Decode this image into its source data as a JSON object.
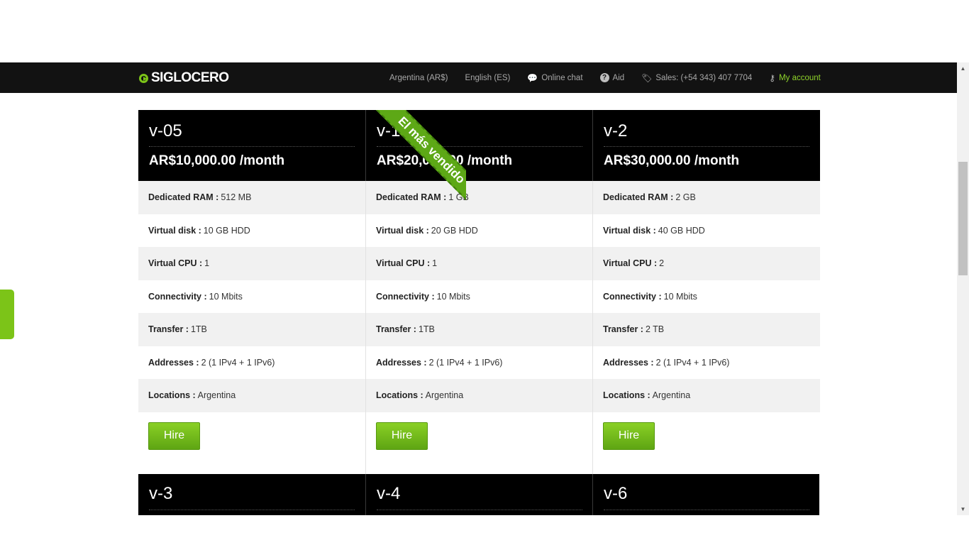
{
  "header": {
    "logo_text": "SIGLOCERO",
    "region": "Argentina (AR$)",
    "language": "English (ES)",
    "chat": "Online chat",
    "aid": "Aid",
    "sales": "Sales: (+54 343) 407 7704",
    "account": "My account"
  },
  "ribbon_text": "El más vendido",
  "hire_label": "Hire",
  "plans": [
    {
      "name": "v-05",
      "price": "AR$10,000.00 /month",
      "specs": [
        {
          "label": "Dedicated RAM :",
          "value": "512 MB"
        },
        {
          "label": "Virtual disk :",
          "value": "10 GB HDD"
        },
        {
          "label": "Virtual CPU :",
          "value": "1"
        },
        {
          "label": "Connectivity :",
          "value": "10 Mbits"
        },
        {
          "label": "Transfer :",
          "value": "1TB"
        },
        {
          "label": "Addresses :",
          "value": "2 (1 IPv4 + 1 IPv6)"
        },
        {
          "label": "Locations :",
          "value": "Argentina"
        }
      ]
    },
    {
      "name": "v-1",
      "price": "AR$20,000.00 /month",
      "specs": [
        {
          "label": "Dedicated RAM :",
          "value": "1 GB"
        },
        {
          "label": "Virtual disk :",
          "value": "20 GB HDD"
        },
        {
          "label": "Virtual CPU :",
          "value": "1"
        },
        {
          "label": "Connectivity :",
          "value": "10 Mbits"
        },
        {
          "label": "Transfer :",
          "value": "1TB"
        },
        {
          "label": "Addresses :",
          "value": "2 (1 IPv4 + 1 IPv6)"
        },
        {
          "label": "Locations :",
          "value": "Argentina"
        }
      ]
    },
    {
      "name": "v-2",
      "price": "AR$30,000.00 /month",
      "specs": [
        {
          "label": "Dedicated RAM :",
          "value": "2 GB"
        },
        {
          "label": "Virtual disk :",
          "value": "40 GB HDD"
        },
        {
          "label": "Virtual CPU :",
          "value": "2"
        },
        {
          "label": "Connectivity :",
          "value": "10 Mbits"
        },
        {
          "label": "Transfer :",
          "value": "2 TB"
        },
        {
          "label": "Addresses :",
          "value": "2 (1 IPv4 + 1 IPv6)"
        },
        {
          "label": "Locations :",
          "value": "Argentina"
        }
      ]
    }
  ],
  "plans_row2": [
    {
      "name": "v-3"
    },
    {
      "name": "v-4"
    },
    {
      "name": "v-6"
    }
  ],
  "colors": {
    "accent": "#7cc418",
    "navbar": "#121212",
    "row_alt": "#f1f1f1"
  }
}
